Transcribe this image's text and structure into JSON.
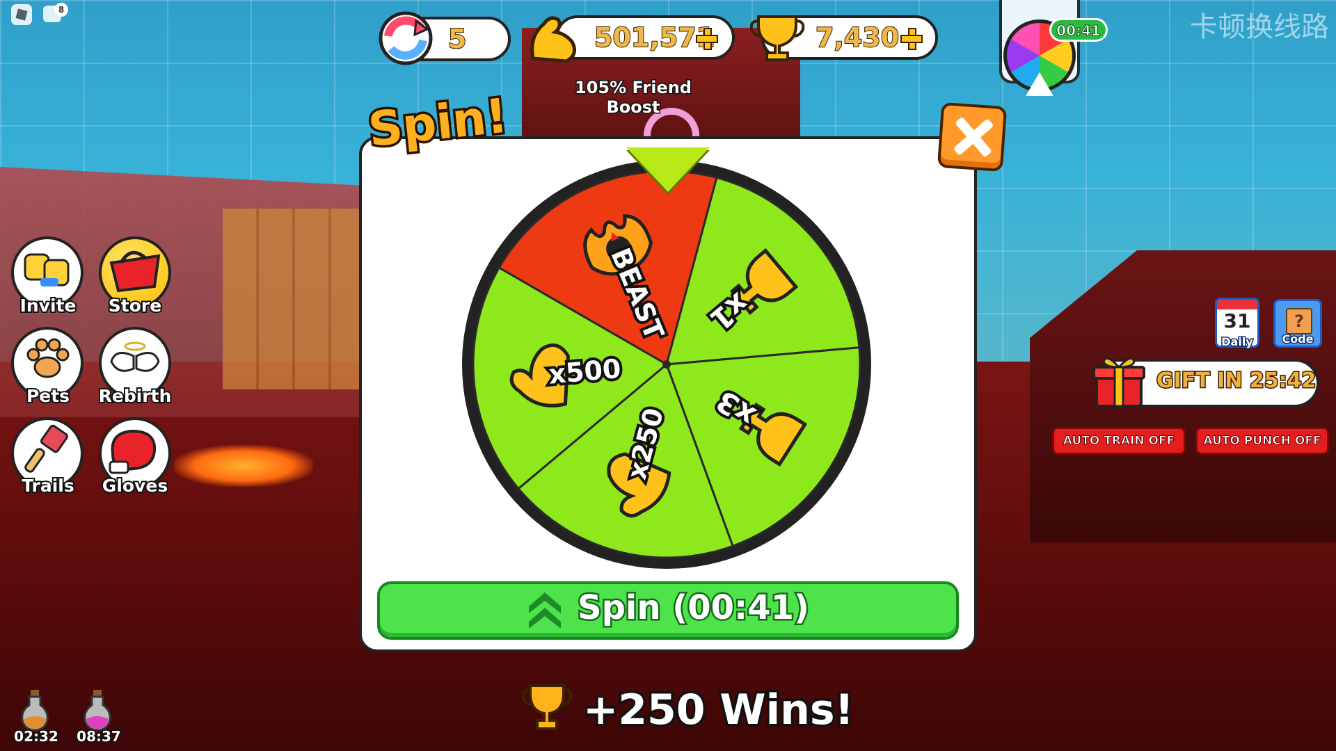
{
  "hud": {
    "rebirths": "5",
    "strength": "501,571",
    "wins": "7,430",
    "friend_boost": "105% Friend Boost",
    "mini_wheel_timer": "00:41",
    "chat_badge": "8",
    "watermark": "卡顿换线路"
  },
  "menu": {
    "items": [
      {
        "label": "Invite",
        "icon": "friends-icon"
      },
      {
        "label": "Store",
        "icon": "shopping-basket-icon"
      },
      {
        "label": "Pets",
        "icon": "paw-icon"
      },
      {
        "label": "Rebirth",
        "icon": "angel-wings-icon"
      },
      {
        "label": "Trails",
        "icon": "paintbrush-icon"
      },
      {
        "label": "Gloves",
        "icon": "boxing-glove-icon"
      }
    ]
  },
  "spin": {
    "title": "Spin!",
    "button_label": "Spin (00:41)",
    "segments": [
      {
        "label": "BEAST",
        "color": "#ee3a12",
        "icon": "beast-emblem-icon"
      },
      {
        "label": "x1",
        "color": "#8fe81c",
        "icon": "trophy-icon"
      },
      {
        "label": "x3",
        "color": "#8fe81c",
        "icon": "trophy-icon"
      },
      {
        "label": "x250",
        "color": "#8fe81c",
        "icon": "flexed-arm-icon"
      },
      {
        "label": "x500",
        "color": "#8fe81c",
        "icon": "flexed-arm-icon"
      }
    ]
  },
  "side": {
    "daily_day": "31",
    "daily_label": "Daily",
    "code_label": "Code",
    "code_icon": "?",
    "gift_label": "GIFT IN 25:42",
    "auto_train": "AUTO TRAIN OFF",
    "auto_punch": "AUTO PUNCH OFF"
  },
  "notification": "+250 Wins!",
  "potions": [
    {
      "time": "02:32",
      "color": "#e09030"
    },
    {
      "time": "08:37",
      "color": "#e040c0"
    }
  ],
  "colors": {
    "accent_gold": "#f0b84a",
    "spin_green": "#4ee34a",
    "close_orange": "#ff9a2a",
    "beast_red": "#ee3a12",
    "wheel_green": "#8fe81c"
  }
}
